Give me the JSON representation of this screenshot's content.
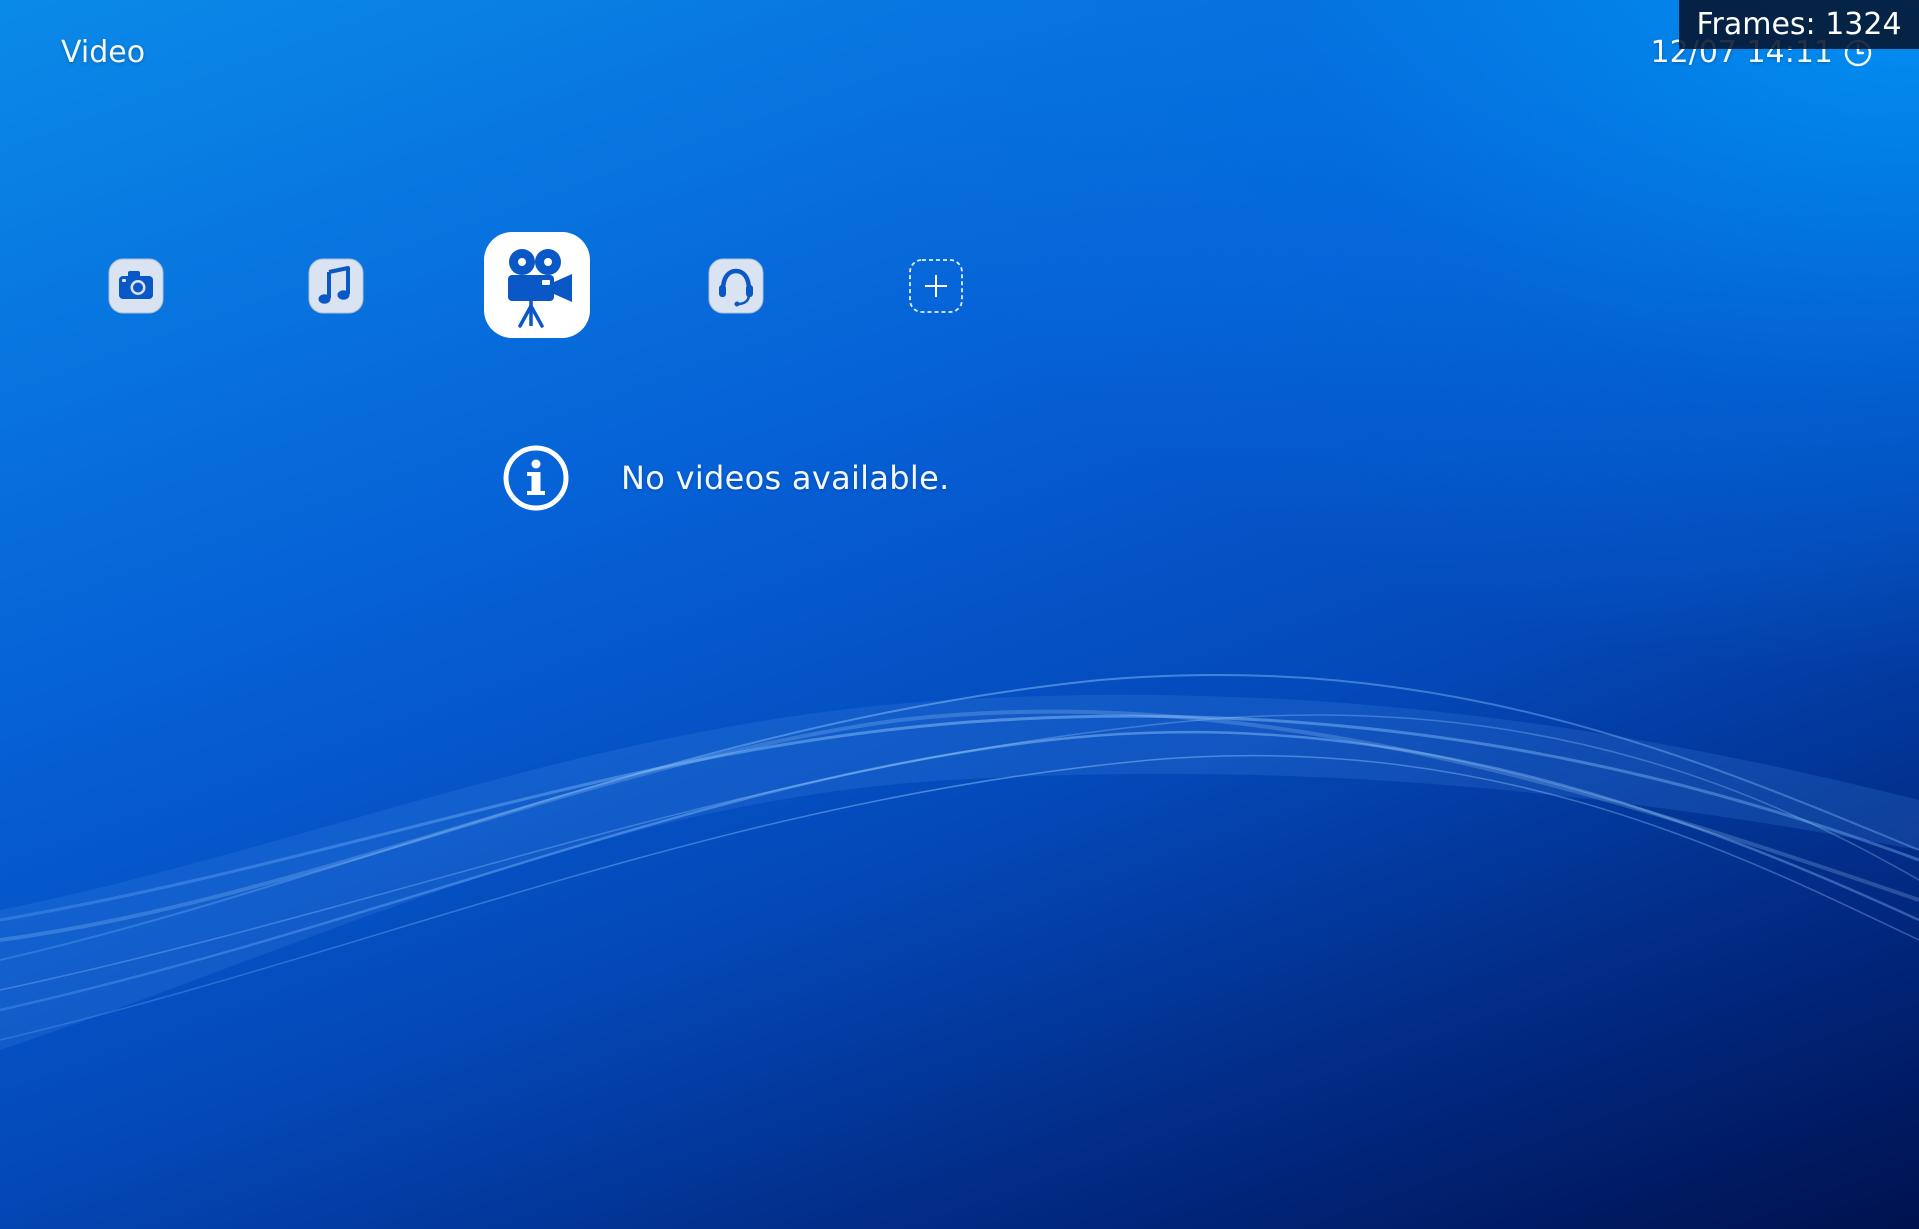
{
  "header": {
    "section_title": "Video",
    "clock_text": "12/07 14:11",
    "clock_icon": "power-clock-icon"
  },
  "overlay": {
    "frames_text": "Frames: 1324"
  },
  "categories": [
    {
      "id": "photo",
      "icon": "camera-icon",
      "selected": false
    },
    {
      "id": "music",
      "icon": "music-note-icon",
      "selected": false
    },
    {
      "id": "video",
      "icon": "movie-camera-icon",
      "selected": true
    },
    {
      "id": "support",
      "icon": "headset-icon",
      "selected": false
    },
    {
      "id": "add",
      "icon": "add-icon",
      "selected": false
    }
  ],
  "content": {
    "message": "No videos available.",
    "message_icon": "info-icon"
  },
  "colors": {
    "accent_icon": "#0a57c6",
    "icon_tile": "#d9e3f2",
    "selected_tile": "#ffffff"
  }
}
